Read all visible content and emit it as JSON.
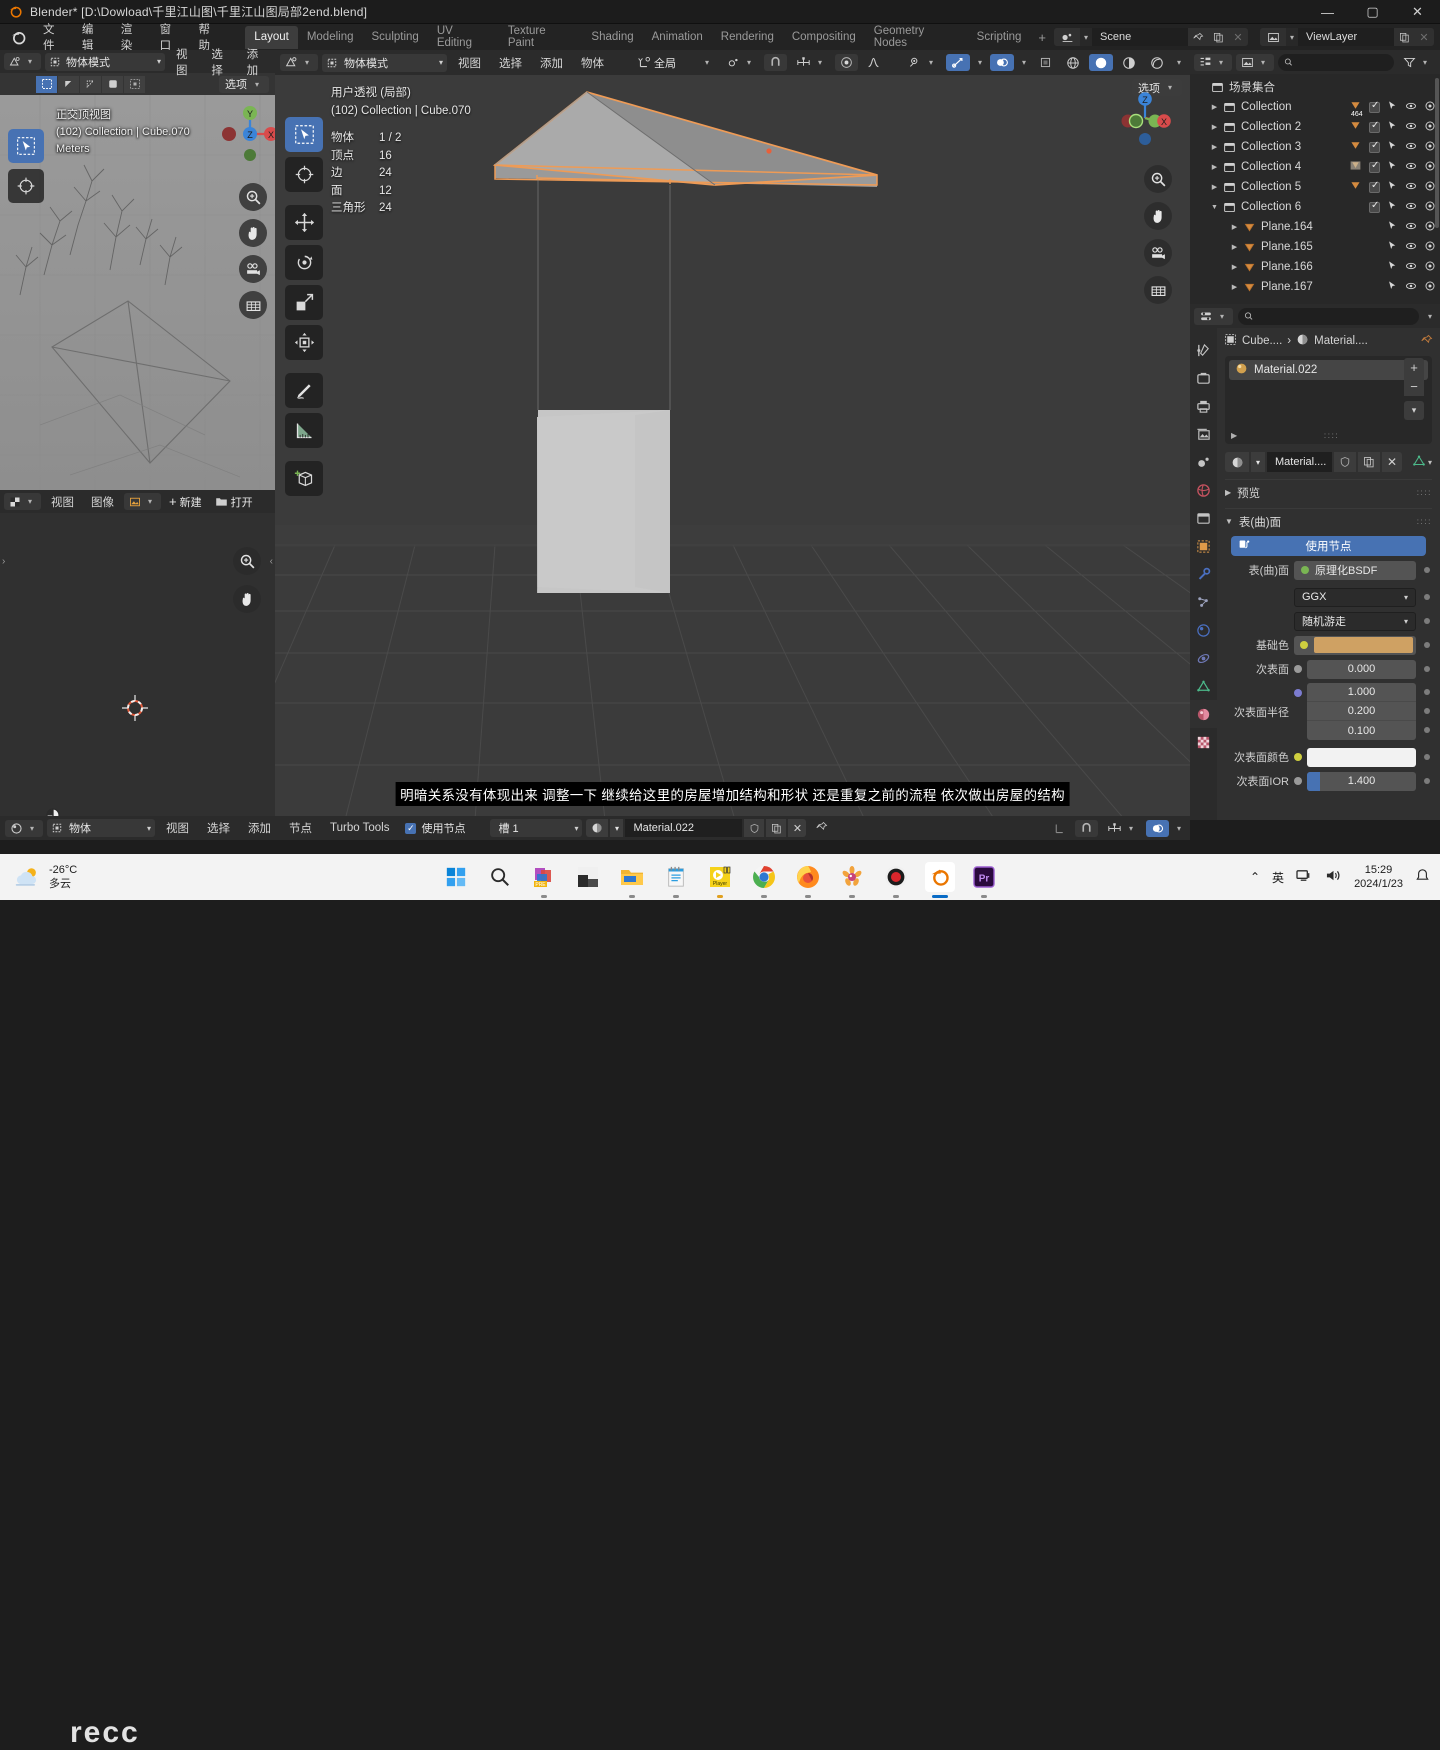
{
  "window": {
    "title": "Blender* [D:\\Dowload\\千里江山图\\千里江山图局部2end.blend]",
    "minimize": "—",
    "maximize": "▢",
    "close": "✕"
  },
  "topbar": {
    "menus": [
      "文件",
      "编辑",
      "渲染",
      "窗口",
      "帮助"
    ],
    "workspaces": [
      "Layout",
      "Modeling",
      "Sculpting",
      "UV Editing",
      "Texture Paint",
      "Shading",
      "Animation",
      "Rendering",
      "Compositing",
      "Geometry Nodes",
      "Scripting"
    ],
    "active_workspace": "Layout",
    "add_workspace": "+",
    "scene_name": "Scene",
    "viewlayer_name": "ViewLayer"
  },
  "left_view3d": {
    "header": {
      "mode": "物体模式",
      "menus": [
        "视图",
        "选择",
        "添加"
      ],
      "options_label": "选项"
    },
    "overlay": {
      "view_name": "正交顶视图",
      "collection_object": "(102) Collection | Cube.070",
      "units": "Meters"
    },
    "gizmo_axes": {
      "x": "X",
      "y": "Y",
      "z": "Z"
    }
  },
  "image_editor": {
    "header": {
      "menus": [
        "视图",
        "图像"
      ],
      "new_label": "新建",
      "open_label": "打开"
    }
  },
  "viewport": {
    "header": {
      "mode": "物体模式",
      "menus": [
        "视图",
        "选择",
        "添加",
        "物体"
      ],
      "transform_orientation": "全局",
      "options_label": "选项"
    },
    "stats": {
      "view_name": "用户透视 (局部)",
      "collection_object": "(102) Collection | Cube.070",
      "rows": [
        {
          "label": "物体",
          "value": "1 / 2"
        },
        {
          "label": "顶点",
          "value": "16"
        },
        {
          "label": "边",
          "value": "24"
        },
        {
          "label": "面",
          "value": "12"
        },
        {
          "label": "三角形",
          "value": "24"
        }
      ]
    },
    "gizmo_axes": {
      "x": "X",
      "y": "Y",
      "z": "Z"
    },
    "subtitle": "明暗关系没有体现出来 调整一下 继续给这里的房屋增加结构和形状 还是重复之前的流程 依次做出房屋的结构"
  },
  "outliner": {
    "title": "场景集合",
    "search_placeholder": "",
    "rows": [
      {
        "label": "Collection",
        "type": "collection",
        "indent": 0,
        "expanded": false,
        "badge": "464",
        "checkbox": true
      },
      {
        "label": "Collection 2",
        "type": "collection",
        "indent": 0,
        "expanded": false,
        "badge": "",
        "checkbox": true
      },
      {
        "label": "Collection 3",
        "type": "collection",
        "indent": 0,
        "expanded": false,
        "badge": "",
        "checkbox": true
      },
      {
        "label": "Collection 4",
        "type": "collection",
        "indent": 0,
        "expanded": false,
        "badge": "",
        "checkbox": true
      },
      {
        "label": "Collection 5",
        "type": "collection",
        "indent": 0,
        "expanded": false,
        "badge": "",
        "checkbox": true
      },
      {
        "label": "Collection 6",
        "type": "collection",
        "indent": 0,
        "expanded": true,
        "badge": "",
        "checkbox": true
      },
      {
        "label": "Plane.164",
        "type": "mesh",
        "indent": 1,
        "expanded": false,
        "badge": "",
        "checkbox": false
      },
      {
        "label": "Plane.165",
        "type": "mesh",
        "indent": 1,
        "expanded": false,
        "badge": "",
        "checkbox": false
      },
      {
        "label": "Plane.166",
        "type": "mesh",
        "indent": 1,
        "expanded": false,
        "badge": "",
        "checkbox": false
      },
      {
        "label": "Plane.167",
        "type": "mesh",
        "indent": 1,
        "expanded": false,
        "badge": "",
        "checkbox": false
      }
    ]
  },
  "properties": {
    "breadcrumb": {
      "object": "Cube....",
      "separator": "›",
      "material": "Material...."
    },
    "material_slot": {
      "name": "Material.022"
    },
    "material_id": {
      "name": "Material...."
    },
    "panels": {
      "preview": "预览",
      "surface": "表(曲)面"
    },
    "use_nodes_label": "使用节点",
    "fields": [
      {
        "name": "surface",
        "label": "表(曲)面",
        "kind": "enum",
        "value": "原理化BSDF",
        "dot": "#7ab553"
      },
      {
        "name": "distribution",
        "label": "",
        "kind": "select",
        "value": "GGX",
        "dot": ""
      },
      {
        "name": "subsurface_method",
        "label": "",
        "kind": "select",
        "value": "随机游走",
        "dot": ""
      },
      {
        "name": "base_color",
        "label": "基础色",
        "kind": "color",
        "value": "#cfa163",
        "dot": "#cfcf3f"
      },
      {
        "name": "subsurface",
        "label": "次表面",
        "kind": "number",
        "value": "0.000",
        "dot": "#9a9a9a"
      },
      {
        "name": "subsurface_radius",
        "label": "次表面半径",
        "kind": "vector",
        "value": [
          "1.000",
          "0.200",
          "0.100"
        ],
        "dot": "#7c7cd0"
      },
      {
        "name": "subsurface_color",
        "label": "次表面颜色",
        "kind": "color",
        "value": "#f2f2f2",
        "dot": "#cfcf3f"
      },
      {
        "name": "subsurface_ior",
        "label": "次表面IOR",
        "kind": "slider",
        "value": "1.400",
        "dot": "#9a9a9a",
        "fill": 12
      }
    ]
  },
  "node_editor": {
    "mode": "物体",
    "menus": [
      "视图",
      "选择",
      "添加",
      "节点",
      "Turbo Tools"
    ],
    "use_nodes_label": "使用节点",
    "use_nodes_checked": true,
    "slot_label": "槽 1",
    "material_name": "Material.022"
  },
  "taskbar": {
    "weather": {
      "temp": "-26°C",
      "cond": "多云"
    },
    "apps": [
      "start-icon",
      "search-icon",
      "office-icon",
      "explorer-dark-icon",
      "file-explorer-icon",
      "notes-icon",
      "player-icon",
      "chrome-icon",
      "firefox-icon",
      "flower-icon",
      "record-icon",
      "blender-icon",
      "premiere-icon"
    ],
    "tray": {
      "chevron": "⌃",
      "ime": "英",
      "network": "网",
      "volume": "🔊",
      "bell": "🔔"
    },
    "clock": {
      "time": "15:29",
      "date": "2024/1/23"
    },
    "watermark": "recc"
  },
  "colors": {
    "accent_blue": "#4772b3",
    "selected_orange": "#ed9e5c",
    "header_bg": "#2b2b2b",
    "editor_bg": "#303030",
    "viewport_bg": "#3b3b3b"
  }
}
